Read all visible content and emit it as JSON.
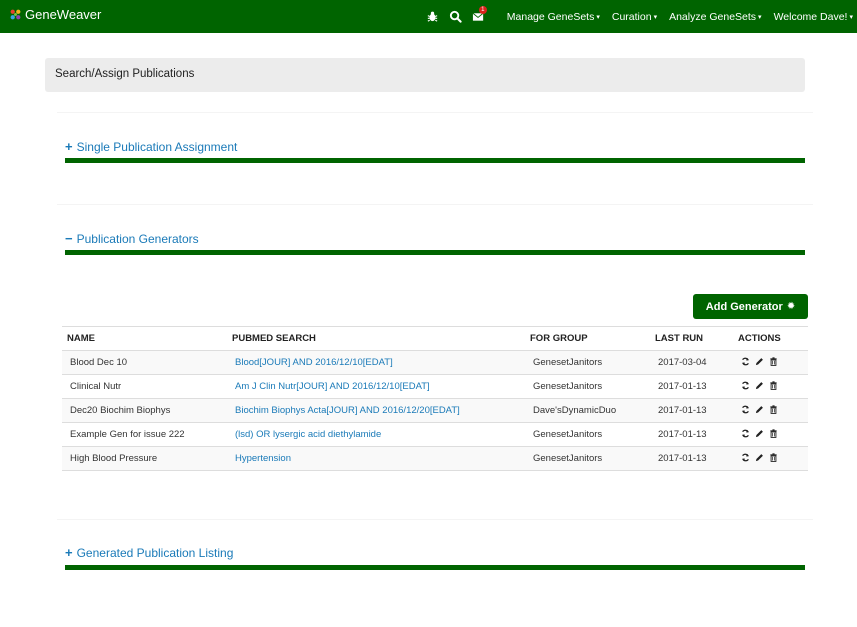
{
  "navbar": {
    "brand": "GeneWeaver",
    "notification_count": "1",
    "menu": [
      {
        "label": "Manage GeneSets"
      },
      {
        "label": "Curation"
      },
      {
        "label": "Analyze GeneSets"
      },
      {
        "label": "Welcome Dave!"
      }
    ]
  },
  "page": {
    "title": "Search/Assign Publications"
  },
  "sections": {
    "single": {
      "sign": "+",
      "label": "Single Publication Assignment"
    },
    "generators": {
      "sign": "−",
      "label": "Publication Generators"
    },
    "listing": {
      "sign": "+",
      "label": "Generated Publication Listing"
    }
  },
  "add_generator_label": "Add Generator",
  "table": {
    "headers": [
      "NAME",
      "PUBMED SEARCH",
      "FOR GROUP",
      "LAST RUN",
      "ACTIONS"
    ],
    "rows": [
      {
        "name": "Blood Dec 10",
        "search": "Blood[JOUR] AND 2016/12/10[EDAT]",
        "group": "GenesetJanitors",
        "last_run": "2017-03-04"
      },
      {
        "name": "Clinical Nutr",
        "search": "Am J Clin Nutr[JOUR] AND 2016/12/10[EDAT]",
        "group": "GenesetJanitors",
        "last_run": "2017-01-13"
      },
      {
        "name": "Dec20 Biochim Biophys",
        "search": "Biochim Biophys Acta[JOUR] AND 2016/12/20[EDAT]",
        "group": "Dave'sDynamicDuo",
        "last_run": "2017-01-13"
      },
      {
        "name": "Example Gen for issue 222",
        "search": "(lsd) OR lysergic acid diethylamide",
        "group": "GenesetJanitors",
        "last_run": "2017-01-13"
      },
      {
        "name": "High Blood Pressure",
        "search": "Hypertension",
        "group": "GenesetJanitors",
        "last_run": "2017-01-13"
      }
    ]
  },
  "colors": {
    "brand_green": "#006400",
    "link_blue": "#1a7ab8",
    "badge_red": "#d9241c"
  },
  "icons": {
    "nav": [
      "bug-icon",
      "search-icon",
      "envelope-icon"
    ],
    "row_actions": [
      "refresh-icon",
      "pencil-icon",
      "trash-icon"
    ],
    "button": "gear-icon"
  }
}
